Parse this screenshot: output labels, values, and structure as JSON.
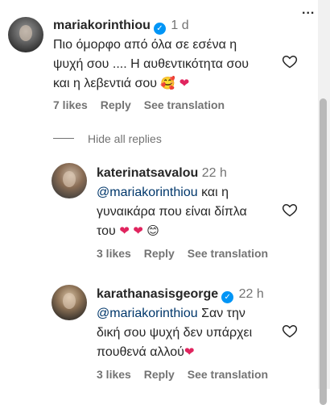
{
  "top_menu": {
    "icon": "more-dots-icon",
    "label": "..."
  },
  "comments": [
    {
      "username": "mariakorinthiou",
      "verified": true,
      "time": "1 d",
      "text_lines": [
        "Πιο όμορφο από όλα σε εσένα η",
        "ψυχή σου .... Η αυθεντικότητα σου",
        "και η λεβεντιά σου"
      ],
      "emojis": [
        "smiling-face-with-hearts",
        "red-heart"
      ],
      "likes": "7 likes",
      "reply": "Reply",
      "translation": "See translation"
    }
  ],
  "replies_toggle": "Hide all replies",
  "replies": [
    {
      "username": "katerinatsavalou",
      "verified": false,
      "time": "22 h",
      "mention": "@mariakorinthiou",
      "text_after_mention": " και η",
      "text_lines": [
        "γυναικάρα που είναι δίπλα",
        "του"
      ],
      "emojis": [
        "red-heart",
        "red-heart",
        "smiling-face-with-smiling-eyes"
      ],
      "likes": "3 likes",
      "reply": "Reply",
      "translation": "See translation"
    },
    {
      "username": "karathanasisgeorge",
      "verified": true,
      "time": "22 h",
      "mention": "@mariakorinthiou",
      "text_after_mention": " Σαν την",
      "text_lines": [
        "δική σου ψυχή δεν υπάρχει",
        "πουθενά αλλού"
      ],
      "emojis": [
        "red-heart"
      ],
      "likes": "3 likes",
      "reply": "Reply",
      "translation": "See translation"
    }
  ],
  "colors": {
    "text": "#262626",
    "secondary": "#737373",
    "mention": "#00376b",
    "verified": "#0095f6",
    "heart": "#e0245e"
  }
}
